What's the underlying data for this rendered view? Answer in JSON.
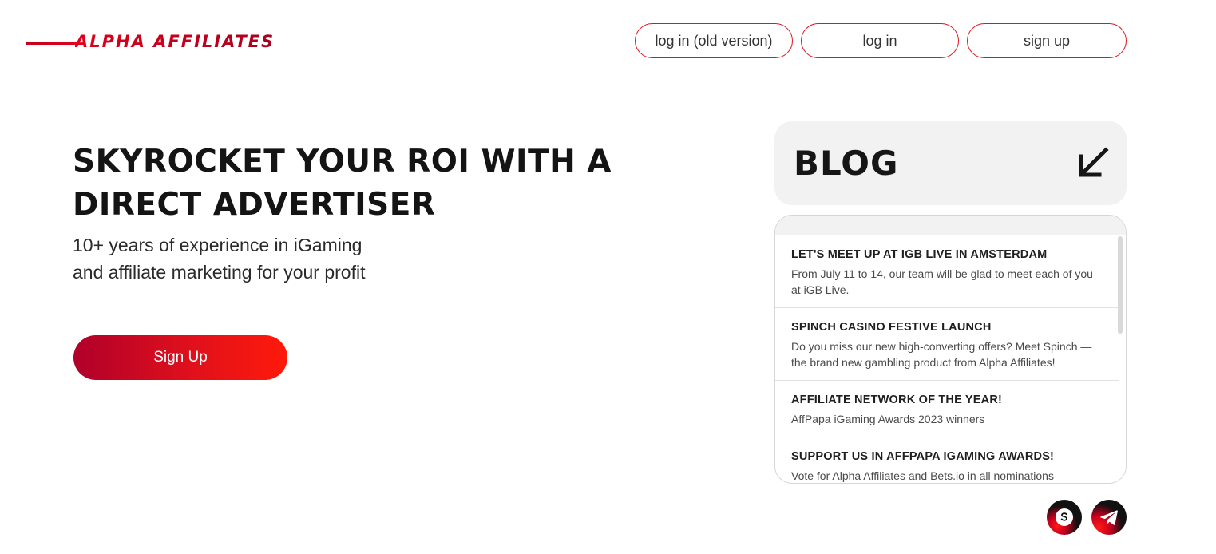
{
  "header": {
    "logo_text": "ALPHA AFFILIATES",
    "buttons": {
      "login_old": "log in (old version)",
      "login": "log in",
      "signup": "sign up"
    }
  },
  "hero": {
    "title": "SKYROCKET YOUR ROI WITH A DIRECT ADVERTISER",
    "subtitle_line1": "10+ years of experience in iGaming",
    "subtitle_line2": "and affiliate marketing for your profit",
    "cta_label": "Sign Up"
  },
  "blog": {
    "title": "BLOG",
    "arrow_icon": "arrow-down-left-icon",
    "posts": [
      {
        "title": "LET'S MEET UP AT IGB LIVE IN AMSTERDAM",
        "desc": "From July 11 to 14, our team will be glad to meet each of you at iGB Live."
      },
      {
        "title": "SPINCH CASINO FESTIVE LAUNCH",
        "desc": "Do you miss our new high-converting offers? Meet Spinch — the brand new gambling product from Alpha Affiliates!"
      },
      {
        "title": "AFFILIATE NETWORK OF THE YEAR!",
        "desc": "AffPapa iGaming Awards 2023 winners"
      },
      {
        "title": "SUPPORT US IN AFFPAPA IGAMING AWARDS!",
        "desc": "Vote for Alpha Affiliates and Bets.io in all nominations"
      }
    ]
  },
  "social": {
    "skype_icon": "skype-icon",
    "telegram_icon": "telegram-icon"
  },
  "colors": {
    "accent": "#e3141e",
    "brand_dark": "#b0002a",
    "text": "#1a1a1a",
    "panel_bg": "#f2f2f2"
  }
}
